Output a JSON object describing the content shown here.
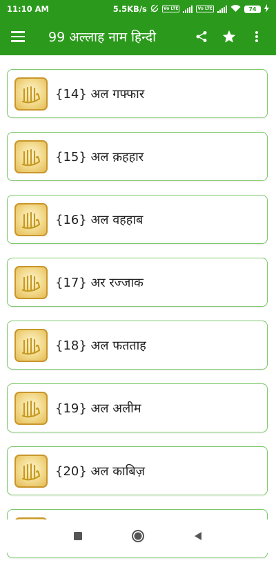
{
  "status_bar": {
    "time": "11:10 AM",
    "network_speed": "5.5KB/s",
    "lte_label_1": "Vo LTE",
    "lte_label_2": "Vo LTE",
    "battery": "74",
    "icons": [
      "sync-off-icon",
      "signal-icon",
      "wifi-icon",
      "battery-icon",
      "charging-icon"
    ]
  },
  "app_bar": {
    "title": "99 अल्लाह नाम हिन्दी",
    "icons": [
      "menu-icon",
      "share-icon",
      "star-icon",
      "more-vert-icon"
    ]
  },
  "list": {
    "items": [
      {
        "label": "{14} अल गफ्फार"
      },
      {
        "label": "{15} अल क़हहार"
      },
      {
        "label": "{16} अल वहहाब"
      },
      {
        "label": "{17} अर रज्जाक"
      },
      {
        "label": "{18} अल फतताह"
      },
      {
        "label": "{19} अल अलीम"
      },
      {
        "label": "{20} अल काबिज़"
      },
      {
        "label": ""
      }
    ]
  },
  "nav_bar": {
    "icons": [
      "recents-square-icon",
      "home-circle-icon",
      "back-triangle-icon"
    ]
  },
  "colors": {
    "primary": "#2b9a1c",
    "card_border": "#7cc96a",
    "thumb_border": "#c9962a"
  }
}
